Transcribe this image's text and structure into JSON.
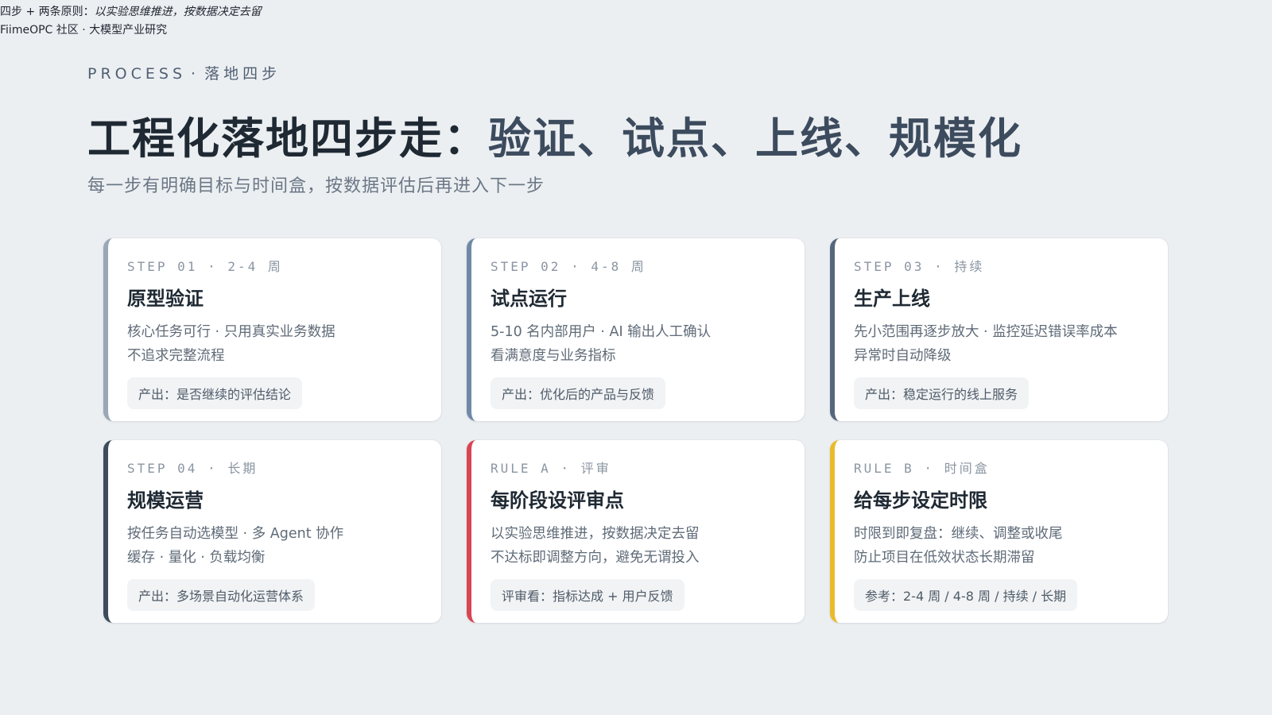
{
  "meta": {
    "caption_prefix": "四步 + 两条原则：",
    "caption_emphasis": "以实验思维推进，按数据决定去留",
    "source": "FiimeOPC 社区 · 大模型产业研究"
  },
  "header": {
    "eyebrow_en": "PROCESS",
    "eyebrow_dot": "·",
    "eyebrow_cn": "落地四步",
    "title_lead": "工程化落地四步走：",
    "title_accent": "验证、试点、上线、规模化",
    "subtitle": "每一步有明确目标与时间盒，按数据评估后再进入下一步"
  },
  "cards": [
    {
      "label": "STEP 01 · 2-4 周",
      "name": "原型验证",
      "line1": "核心任务可行 · 只用真实业务数据",
      "line2": "不追求完整流程",
      "output": "产出：是否继续的评估结论",
      "accent": "#9aa7b6"
    },
    {
      "label": "STEP 02 · 4-8 周",
      "name": "试点运行",
      "line1": "5-10 名内部用户 · AI 输出人工确认",
      "line2": "看满意度与业务指标",
      "output": "产出：优化后的产品与反馈",
      "accent": "#6f8aa6"
    },
    {
      "label": "STEP 03 · 持续",
      "name": "生产上线",
      "line1": "先小范围再逐步放大 · 监控延迟错误率成本",
      "line2": "异常时自动降级",
      "output": "产出：稳定运行的线上服务",
      "accent": "#56677c"
    },
    {
      "label": "STEP 04 · 长期",
      "name": "规模运营",
      "line1": "按任务自动选模型 · 多 Agent 协作",
      "line2": "缓存 · 量化 · 负载均衡",
      "output": "产出：多场景自动化运营体系",
      "accent": "#3e4b5c"
    },
    {
      "label": "RULE A · 评审",
      "name": "每阶段设评审点",
      "line1": "以实验思维推进，按数据决定去留",
      "line2": "不达标即调整方向，避免无谓投入",
      "output": "评审看：指标达成 + 用户反馈",
      "accent": "#d84553"
    },
    {
      "label": "RULE B · 时间盒",
      "name": "给每步设定时限",
      "line1": "时限到即复盘：继续、调整或收尾",
      "line2": "防止项目在低效状态长期滞留",
      "output": "参考：2-4 周 / 4-8 周 / 持续 / 长期",
      "accent": "#e9bb2a"
    }
  ]
}
